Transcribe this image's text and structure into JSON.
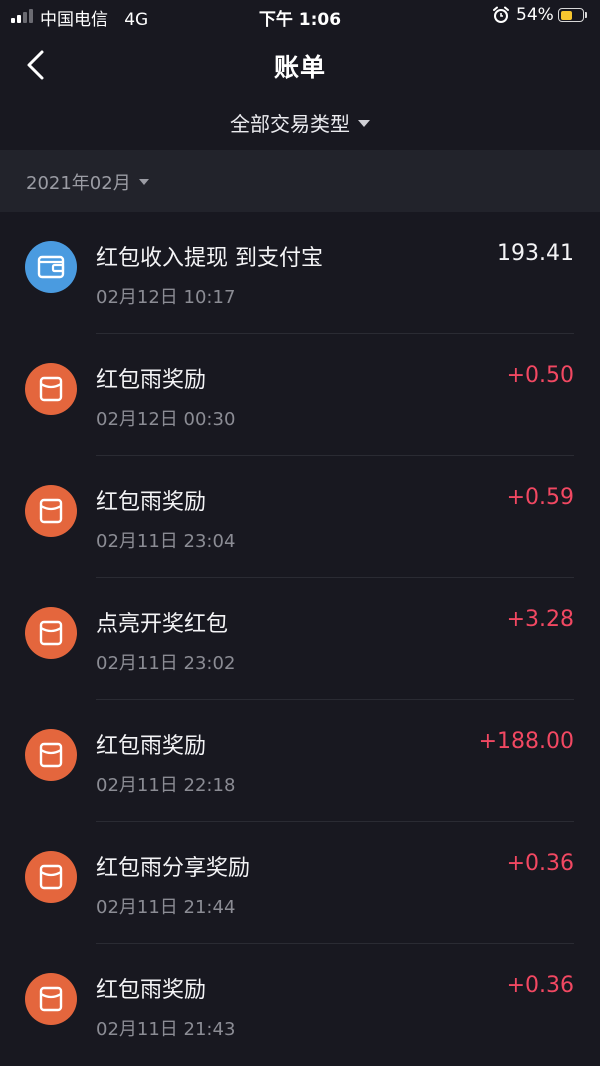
{
  "status_bar": {
    "carrier": "中国电信",
    "network": "4G",
    "time": "下午 1:06",
    "battery_percent": "54%",
    "battery_level": 0.54
  },
  "nav": {
    "title": "账单"
  },
  "filter": {
    "label": "全部交易类型"
  },
  "month": {
    "label": "2021年02月"
  },
  "transactions": [
    {
      "title": "红包收入提现 到支付宝",
      "time": "02月12日 10:17",
      "amount": "193.41",
      "icon": "wallet-icon",
      "icon_color": "#4a9be0"
    },
    {
      "title": "红包雨奖励",
      "time": "02月12日 00:30",
      "amount": "+0.50",
      "icon": "red-packet-icon",
      "icon_color": "#e4663d"
    },
    {
      "title": "红包雨奖励",
      "time": "02月11日 23:04",
      "amount": "+0.59",
      "icon": "red-packet-icon",
      "icon_color": "#e4663d"
    },
    {
      "title": "点亮开奖红包",
      "time": "02月11日 23:02",
      "amount": "+3.28",
      "icon": "red-packet-icon",
      "icon_color": "#e4663d"
    },
    {
      "title": "红包雨奖励",
      "time": "02月11日 22:18",
      "amount": "+188.00",
      "icon": "red-packet-icon",
      "icon_color": "#e4663d"
    },
    {
      "title": "红包雨分享奖励",
      "time": "02月11日 21:44",
      "amount": "+0.36",
      "icon": "red-packet-icon",
      "icon_color": "#e4663d"
    },
    {
      "title": "红包雨奖励",
      "time": "02月11日 21:43",
      "amount": "+0.36",
      "icon": "red-packet-icon",
      "icon_color": "#e4663d"
    }
  ],
  "colors": {
    "background": "#181820",
    "section_header": "#22232b",
    "income_amount": "#f24862"
  }
}
